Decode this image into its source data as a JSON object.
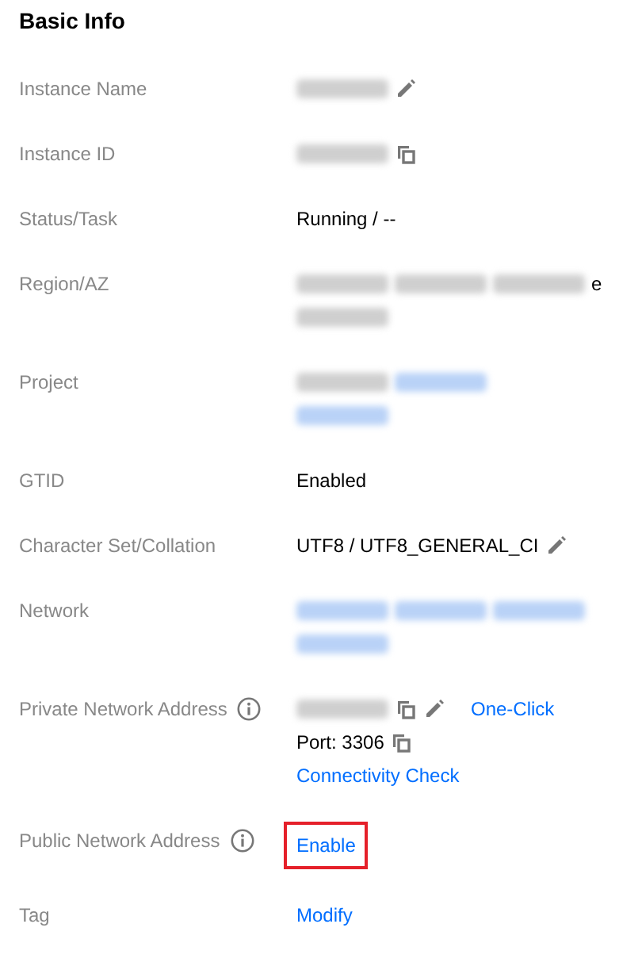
{
  "title": "Basic Info",
  "rows": [
    {
      "label": "Instance Name",
      "info": false,
      "lines": [
        [
          {
            "kind": "blur"
          },
          {
            "kind": "edit"
          }
        ]
      ]
    },
    {
      "label": "Instance ID",
      "info": false,
      "lines": [
        [
          {
            "kind": "blur"
          },
          {
            "kind": "copy"
          }
        ]
      ]
    },
    {
      "label": "Status/Task",
      "info": false,
      "lines": [
        [
          {
            "kind": "text",
            "text": "Running / --"
          }
        ]
      ]
    },
    {
      "label": "Region/AZ",
      "info": false,
      "lines": [
        [
          {
            "kind": "blur"
          },
          {
            "kind": "blur"
          },
          {
            "kind": "blur"
          },
          {
            "kind": "text",
            "text": "e"
          }
        ],
        [
          {
            "kind": "blur"
          }
        ]
      ]
    },
    {
      "label": "Project",
      "info": false,
      "lines": [
        [
          {
            "kind": "blur"
          },
          {
            "kind": "blur-link"
          }
        ],
        [
          {
            "kind": "blur-link"
          }
        ]
      ]
    },
    {
      "label": "GTID",
      "info": false,
      "lines": [
        [
          {
            "kind": "text",
            "text": "Enabled"
          }
        ]
      ]
    },
    {
      "label": "Character Set/Collation",
      "info": false,
      "lines": [
        [
          {
            "kind": "text",
            "text": "UTF8 / UTF8_GENERAL_CI"
          },
          {
            "kind": "edit"
          }
        ]
      ]
    },
    {
      "label": "Network",
      "info": false,
      "lines": [
        [
          {
            "kind": "blur-link"
          },
          {
            "kind": "blur-link"
          },
          {
            "kind": "blur-link"
          }
        ],
        [
          {
            "kind": "blur-link"
          }
        ]
      ]
    },
    {
      "label": "Private Network Address",
      "info": true,
      "lines": [
        [
          {
            "kind": "blur"
          },
          {
            "kind": "copy"
          },
          {
            "kind": "edit"
          },
          {
            "kind": "link",
            "text": "One-Click",
            "highlighted": false
          }
        ],
        [
          {
            "kind": "text",
            "text": "Port: 3306"
          },
          {
            "kind": "copy"
          }
        ],
        [
          {
            "kind": "link",
            "text": "Connectivity Check",
            "highlighted": false
          }
        ]
      ]
    },
    {
      "label": "Public Network Address",
      "info": true,
      "lines": [
        [
          {
            "kind": "link",
            "text": "Enable",
            "highlighted": true
          }
        ]
      ]
    },
    {
      "label": "Tag",
      "info": false,
      "lines": [
        [
          {
            "kind": "link",
            "text": "Modify",
            "highlighted": false
          }
        ]
      ]
    }
  ]
}
